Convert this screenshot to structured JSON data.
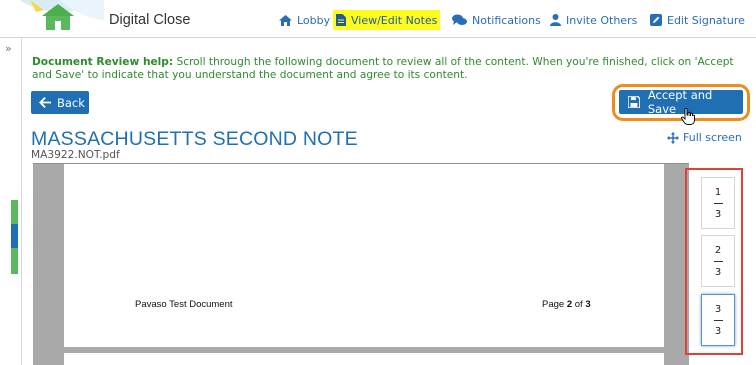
{
  "brand": "Digital Close",
  "nav": {
    "lobby": "Lobby",
    "view_edit_notes": "View/Edit Notes",
    "notifications": "Notifications",
    "invite_others": "Invite Others",
    "edit_signature": "Edit Signature"
  },
  "help": {
    "title": "Document Review help:",
    "text": "Scroll through the following document to review all of the content. When you're finished, click on 'Accept and Save' to indicate that you understand the document and agree to its content."
  },
  "buttons": {
    "back": "Back",
    "accept_save": "Accept and Save",
    "full_screen": "Full screen"
  },
  "document": {
    "title": "MASSACHUSETTS SECOND NOTE",
    "filename": "MA3922.NOT.pdf",
    "footer_left": "Pavaso Test Document",
    "footer_page_prefix": "Page",
    "footer_page_current": "2",
    "footer_page_of": "of",
    "footer_page_total": "3"
  },
  "thumbnails": [
    {
      "num": "1",
      "den": "3"
    },
    {
      "num": "2",
      "den": "3"
    },
    {
      "num": "3",
      "den": "3"
    }
  ],
  "colors": {
    "accent": "#1f6fb2",
    "help_text": "#2e8b2e",
    "highlight_nav": "#fffb1f",
    "accept_outline": "#f08c1e",
    "thumb_outline": "#e0403a"
  }
}
